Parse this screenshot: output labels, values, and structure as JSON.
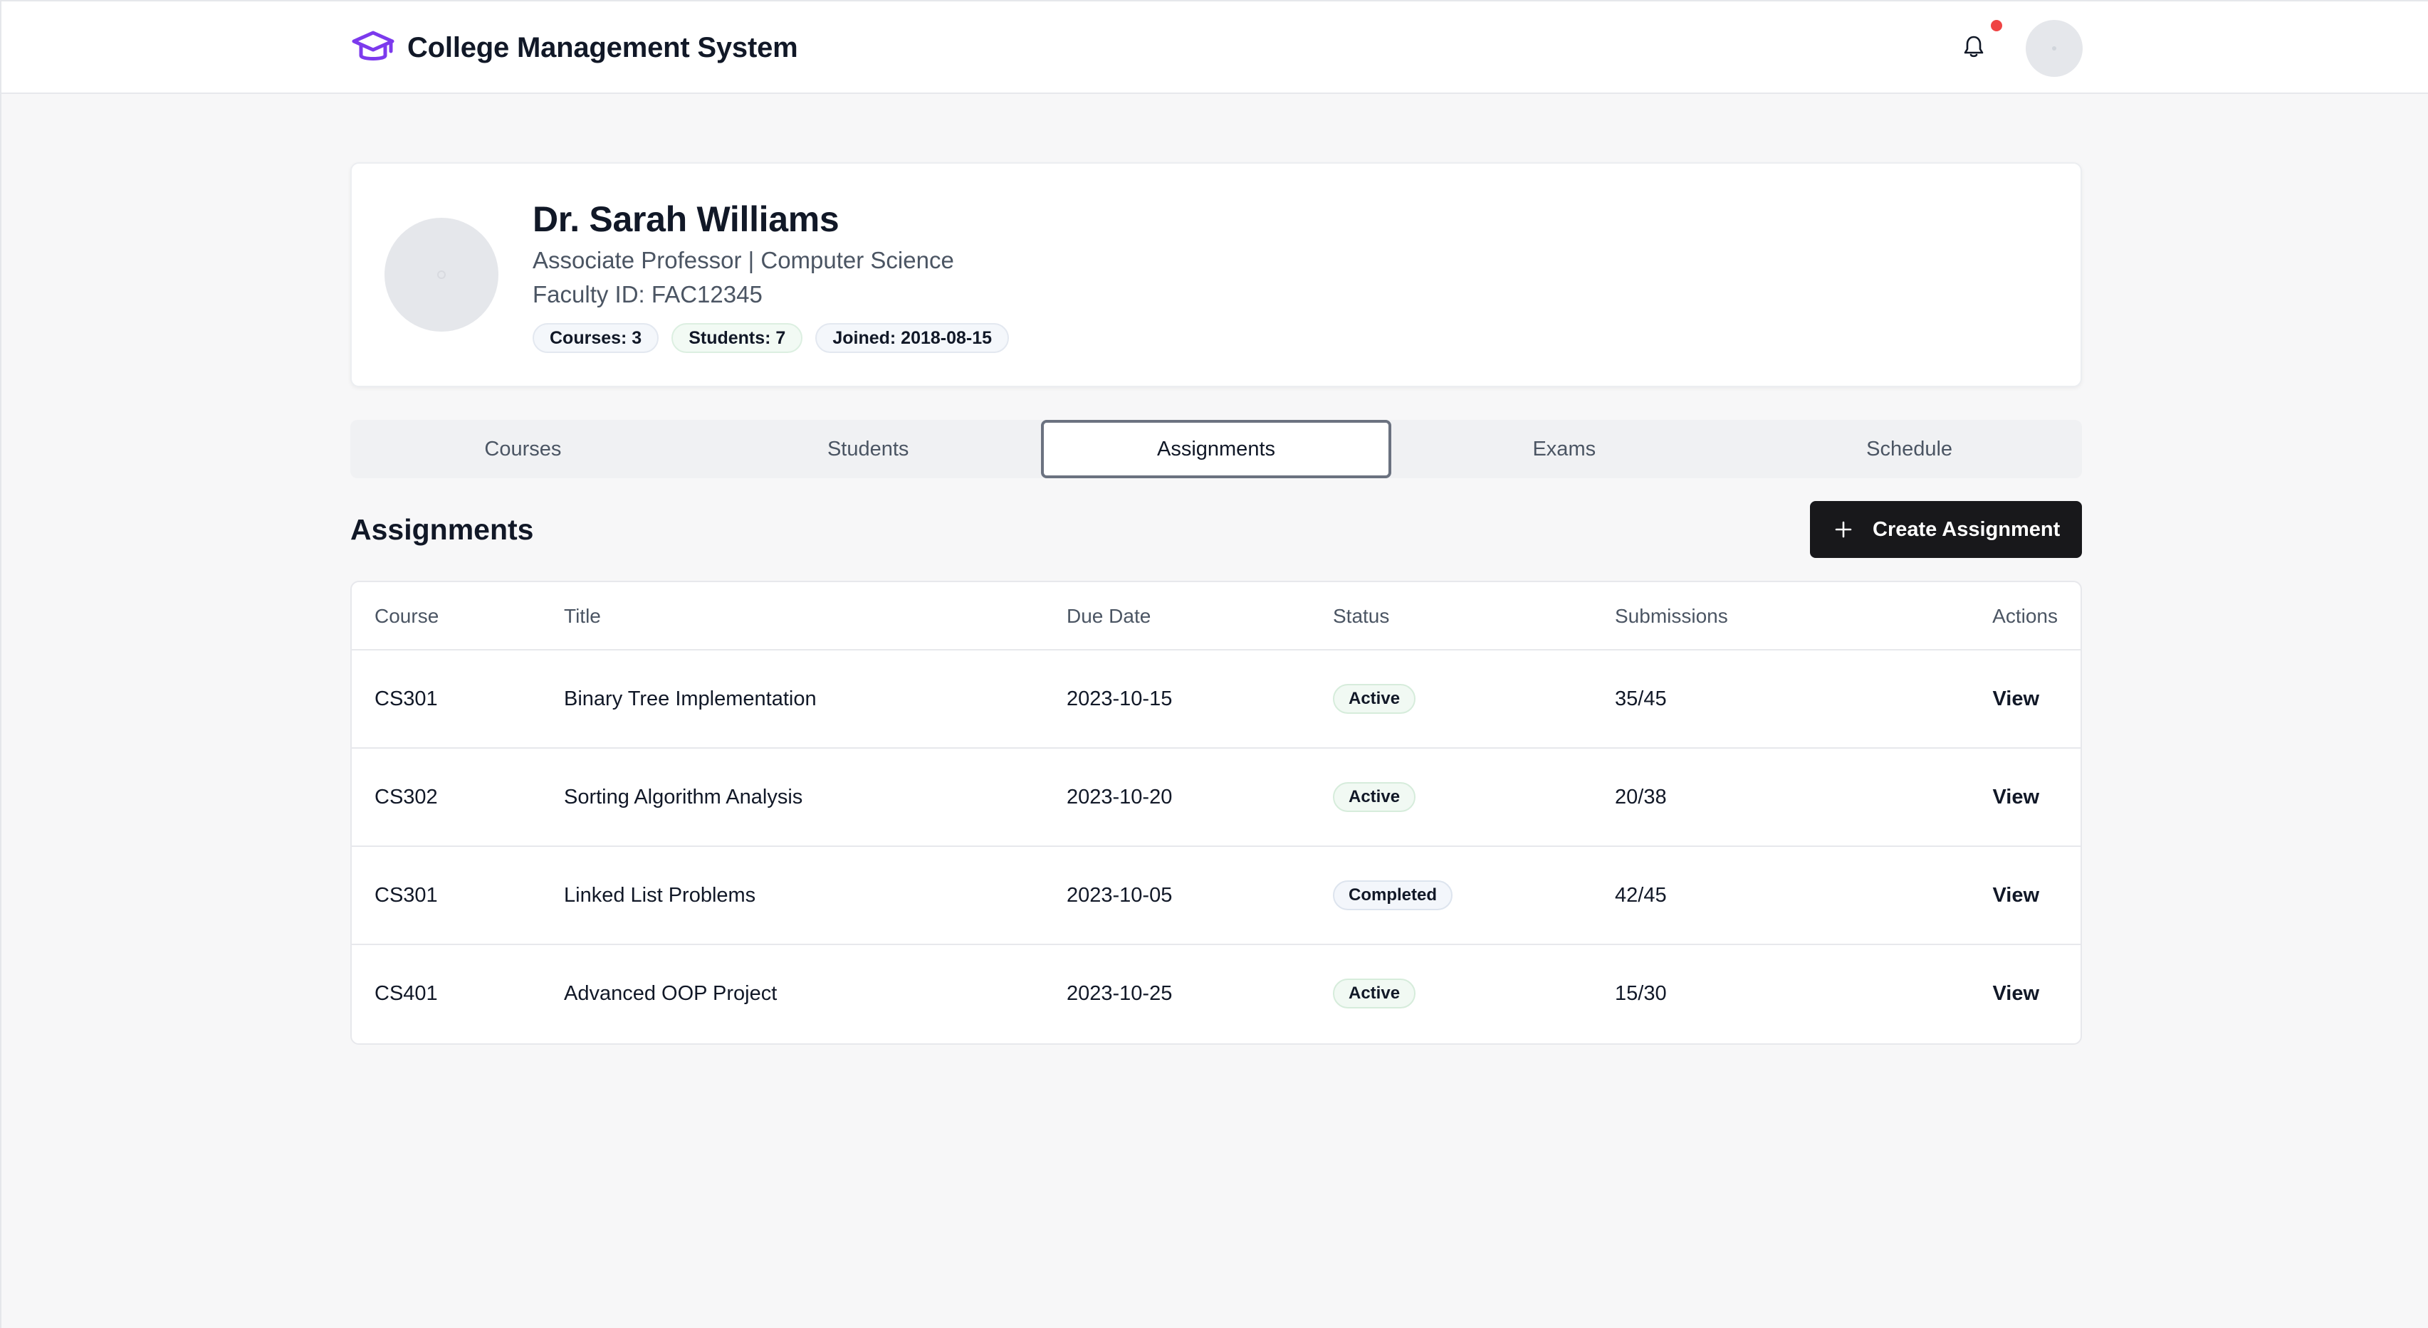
{
  "app": {
    "title": "College Management System",
    "accent_color": "#7c3aed",
    "notification_dot_color": "#ef4444"
  },
  "header": {
    "logo_icon": "graduation-cap-icon",
    "notification_icon": "bell-icon"
  },
  "profile": {
    "name": "Dr. Sarah Williams",
    "position": "Associate Professor | Computer Science",
    "faculty_id": "Faculty ID: FAC12345",
    "badges": {
      "courses": "Courses: 3",
      "students": "Students: 7",
      "joined": "Joined: 2018-08-15"
    }
  },
  "tabs": [
    {
      "label": "Courses",
      "active": false
    },
    {
      "label": "Students",
      "active": false
    },
    {
      "label": "Assignments",
      "active": true
    },
    {
      "label": "Exams",
      "active": false
    },
    {
      "label": "Schedule",
      "active": false
    }
  ],
  "assignments": {
    "title": "Assignments",
    "create_button": "Create Assignment",
    "columns": {
      "course": "Course",
      "title": "Title",
      "due_date": "Due Date",
      "status": "Status",
      "submissions": "Submissions",
      "actions": "Actions"
    },
    "rows": [
      {
        "course": "CS301",
        "title": "Binary Tree Implementation",
        "due_date": "2023-10-15",
        "status": "Active",
        "submissions": "35/45",
        "action": "View"
      },
      {
        "course": "CS302",
        "title": "Sorting Algorithm Analysis",
        "due_date": "2023-10-20",
        "status": "Active",
        "submissions": "20/38",
        "action": "View"
      },
      {
        "course": "CS301",
        "title": "Linked List Problems",
        "due_date": "2023-10-05",
        "status": "Completed",
        "submissions": "42/45",
        "action": "View"
      },
      {
        "course": "CS401",
        "title": "Advanced OOP Project",
        "due_date": "2023-10-25",
        "status": "Active",
        "submissions": "15/30",
        "action": "View"
      }
    ]
  }
}
